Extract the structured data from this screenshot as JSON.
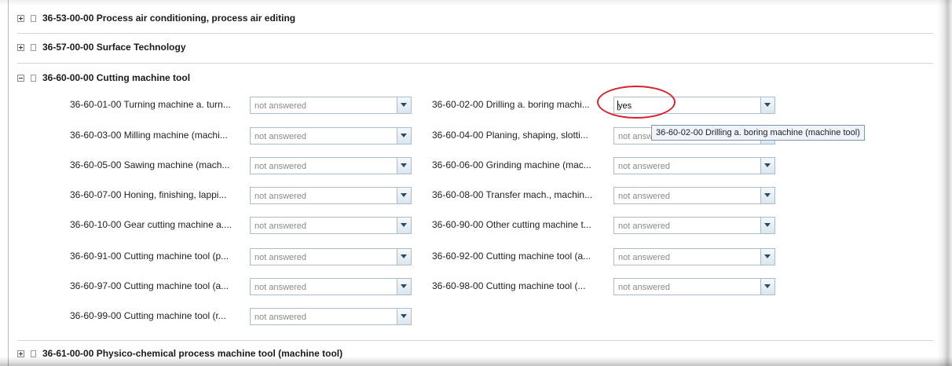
{
  "sections": {
    "top": {
      "label": "36-53-00-00 Process air conditioning, process air editing"
    },
    "surface": {
      "label": "36-57-00-00 Surface Technology"
    },
    "cutting": {
      "label": "36-60-00-00 Cutting machine tool"
    },
    "physico": {
      "label": "36-61-00-00 Physico-chemical process machine tool (machine tool)"
    }
  },
  "fields": [
    {
      "label": "36-60-01-00 Turning machine a. turn...",
      "value": "not answered"
    },
    {
      "label": "36-60-02-00 Drilling a. boring machi...",
      "value": "yes"
    },
    {
      "label": "36-60-03-00 Milling machine (machi...",
      "value": "not answered"
    },
    {
      "label": "36-60-04-00 Planing, shaping, slotti...",
      "value": "not answw"
    },
    {
      "label": "36-60-05-00 Sawing machine (mach...",
      "value": "not answered"
    },
    {
      "label": "36-60-06-00 Grinding machine (mac...",
      "value": "not answered"
    },
    {
      "label": "36-60-07-00 Honing, finishing, lappi...",
      "value": "not answered"
    },
    {
      "label": "36-60-08-00 Transfer mach., machin...",
      "value": "not answered"
    },
    {
      "label": "36-60-10-00 Gear cutting machine a....",
      "value": "not answered"
    },
    {
      "label": "36-60-90-00 Other cutting machine t...",
      "value": "not answered"
    },
    {
      "label": "36-60-91-00 Cutting machine tool (p...",
      "value": "not answered"
    },
    {
      "label": "36-60-92-00 Cutting machine tool (a...",
      "value": "not answered"
    },
    {
      "label": "36-60-97-00 Cutting machine tool (a...",
      "value": "not answered"
    },
    {
      "label": "36-60-98-00 Cutting machine tool (...",
      "value": "not answered"
    },
    {
      "label": "36-60-99-00 Cutting machine tool (r...",
      "value": "not answered"
    }
  ],
  "tooltip": {
    "text": "36-60-02-00 Drilling a. boring machine (machine tool)"
  },
  "colors": {
    "annotation_red": "#d9232e",
    "field_border": "#a9bccd",
    "tooltip_bg": "#eef4fa"
  }
}
